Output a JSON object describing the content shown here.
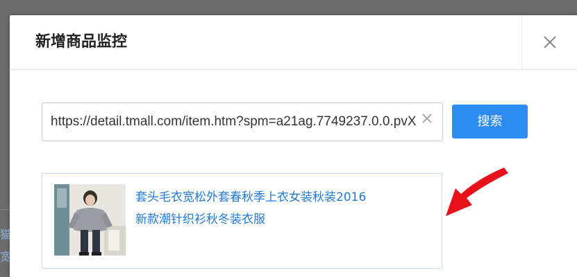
{
  "dialog": {
    "title": "新增商品监控",
    "close_icon": "close-icon"
  },
  "search": {
    "url_value": "https://detail.tmall.com/item.htm?spm=a21ag.7749237.0.0.pvX",
    "button_label": "搜索",
    "clear_icon": "clear-icon"
  },
  "result": {
    "title": "套头毛衣宽松外套春秋季上衣女装秋装2016新款潮针织衫秋冬装衣服",
    "link_color": "#1f7ad6"
  },
  "background": {
    "fragments": [
      "猫",
      "宽"
    ]
  },
  "colors": {
    "accent": "#2d8cf0",
    "annotation_arrow": "#e8101a"
  }
}
